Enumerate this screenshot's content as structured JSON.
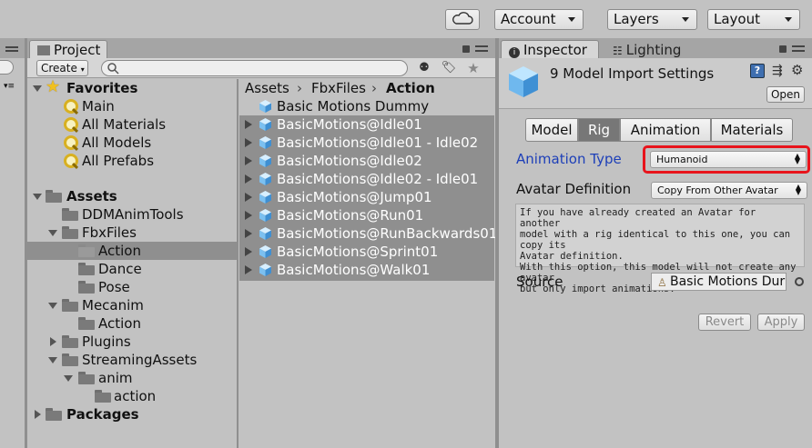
{
  "toolbar": {
    "cloud_icon": "cloud-icon",
    "account_label": "Account",
    "layers_label": "Layers",
    "layout_label": "Layout"
  },
  "project": {
    "tab_label": "Project",
    "create_label": "Create",
    "search_placeholder": "",
    "favorites": {
      "label": "Favorites",
      "items": [
        "Main",
        "All Materials",
        "All Models",
        "All Prefabs"
      ]
    },
    "assets": {
      "label": "Assets",
      "tree": [
        "DDMAnimTools",
        "FbxFiles",
        "Action",
        "Dance",
        "Pose",
        "Mecanim",
        "Action",
        "Plugins",
        "StreamingAssets",
        "anim",
        "action"
      ]
    },
    "packages_label": "Packages",
    "breadcrumb": [
      "Assets",
      "FbxFiles",
      "Action"
    ],
    "asset_list": [
      "Basic Motions Dummy",
      "BasicMotions@Idle01",
      "BasicMotions@Idle01 - Idle02",
      "BasicMotions@Idle02",
      "BasicMotions@Idle02 - Idle01",
      "BasicMotions@Jump01",
      "BasicMotions@Run01",
      "BasicMotions@RunBackwards01",
      "BasicMotions@Sprint01",
      "BasicMotions@Walk01"
    ]
  },
  "inspector": {
    "tab_label": "Inspector",
    "lighting_label": "Lighting",
    "title": "9 Model Import Settings",
    "open_label": "Open",
    "tabs": [
      "Model",
      "Rig",
      "Animation",
      "Materials"
    ],
    "active_tab": "Rig",
    "animation_type_label": "Animation Type",
    "animation_type_value": "Humanoid",
    "avatar_definition_label": "Avatar Definition",
    "avatar_definition_value": "Copy From Other Avatar",
    "help_text_1": "If you have already created an Avatar for another",
    "help_text_2": "model with a rig identical to this one, you can copy its",
    "help_text_3": "Avatar definition.",
    "help_text_4": "With this option, this model will not create any avatar",
    "help_text_5": "but only import animations.",
    "source_label": "Source",
    "source_value": "Basic Motions Dur",
    "revert_label": "Revert",
    "apply_label": "Apply",
    "highlight_color": "#e8141c"
  }
}
